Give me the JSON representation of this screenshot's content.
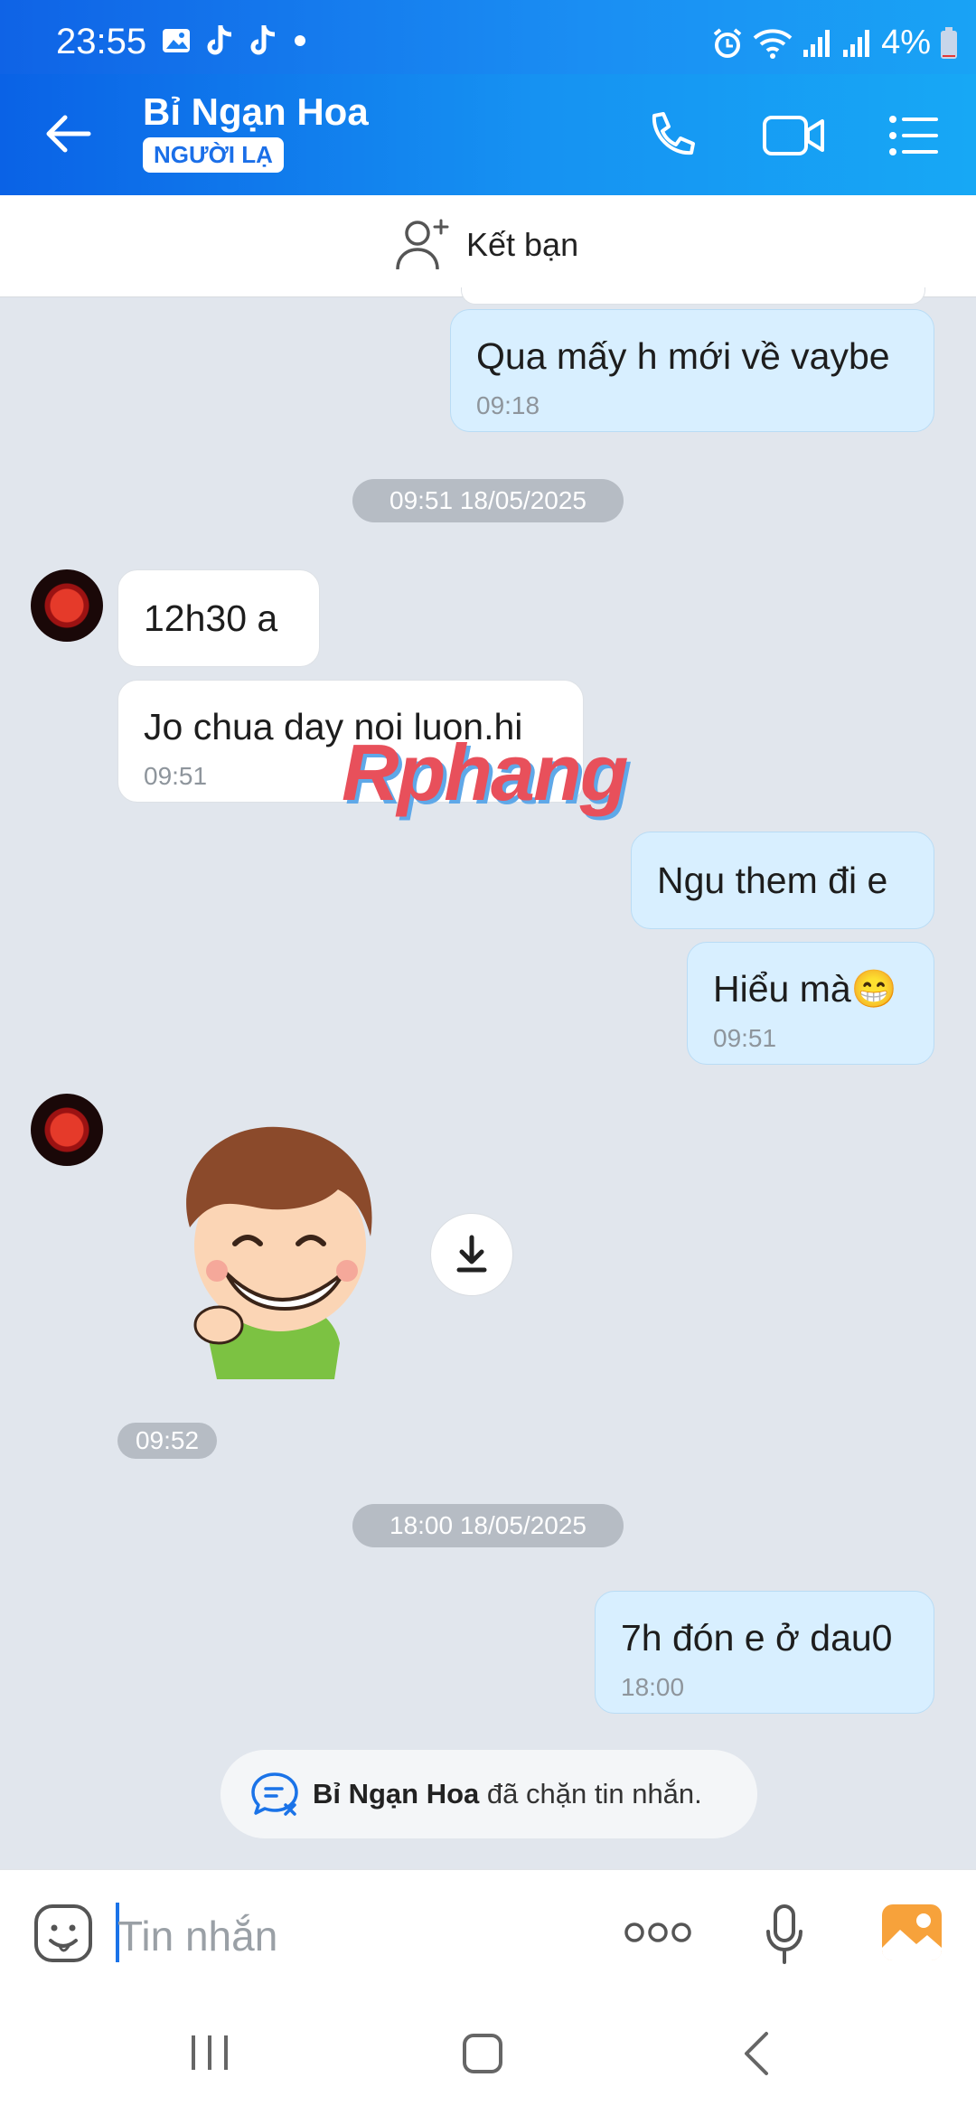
{
  "status_bar": {
    "time": "23:55",
    "battery": "4%"
  },
  "header": {
    "contact_name": "Bỉ Ngạn Hoa",
    "badge": "NGƯỜI LẠ"
  },
  "add_friend": {
    "label": "Kết bạn"
  },
  "messages": {
    "m1": {
      "text": "Qua mấy h mới về vaybe",
      "time": "09:18"
    },
    "date1": "09:51 18/05/2025",
    "m2": {
      "text": "12h30 a"
    },
    "m3": {
      "text": "Jo chua day noi luon.hi",
      "time": "09:51"
    },
    "m4": {
      "text": "Ngu them đi e"
    },
    "m5": {
      "text": "Hiểu mà😁",
      "time": "09:51"
    },
    "sticker_time": "09:52",
    "date2": "18:00 18/05/2025",
    "m6": {
      "text": "7h đón e ở dau0",
      "time": "18:00"
    }
  },
  "watermark": "Rphang",
  "blocked_notice": {
    "name": "Bỉ Ngạn Hoa",
    "text": "đã chặn tin nhắn."
  },
  "composer": {
    "placeholder": "Tin nhắn"
  },
  "colors": {
    "accent": "#1a8ef3",
    "my_bubble": "#d8efff",
    "their_bubble": "#ffffff",
    "background": "#e1e6ed"
  }
}
